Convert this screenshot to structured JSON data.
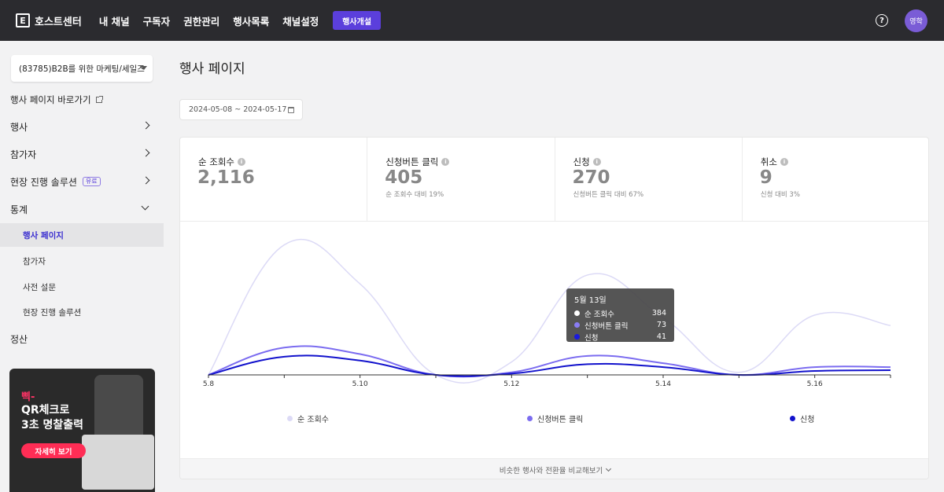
{
  "header": {
    "logo_glyph": "E",
    "brand": "호스트센터",
    "nav": [
      "내 채널",
      "구독자",
      "권한관리",
      "행사목록",
      "채널설정"
    ],
    "create_button": "행사개설",
    "help_glyph": "?",
    "avatar": "영학"
  },
  "sidebar": {
    "channel": "(83785)B2B를 위한 마케팅/세일즈",
    "shortcut": "행사 페이지 바로가기",
    "menu": {
      "event": "행사",
      "participant": "참가자",
      "onsite": "현장 진행 솔루션",
      "onsite_badge": "유료",
      "stats": "통계",
      "settlement": "정산"
    },
    "stats_sub": [
      "행사 페이지",
      "참가자",
      "사전 설문",
      "현장 진행 솔루션"
    ],
    "banner": {
      "tag": "삑-",
      "title_line1": "QR체크로",
      "title_line2": "3초 명찰출력",
      "button": "자세히 보기"
    }
  },
  "main": {
    "title": "행사 페이지",
    "date_range": "2024-05-08 ~ 2024-05-17",
    "stats": [
      {
        "label": "순 조회수",
        "value": "2,116",
        "sub": ""
      },
      {
        "label": "신청버튼 클릭",
        "value": "405",
        "sub": "순 조회수 대비 19%"
      },
      {
        "label": "신청",
        "value": "270",
        "sub": "신청버튼 클릭 대비 67%"
      },
      {
        "label": "취소",
        "value": "9",
        "sub": "신청 대비 3%"
      }
    ],
    "compare": "비슷한 행사와 전환율 비교해보기"
  },
  "chart_data": {
    "type": "line",
    "x": [
      "5.8",
      "5.9",
      "5.10",
      "5.11",
      "5.12",
      "5.13",
      "5.14",
      "5.15",
      "5.16",
      "5.17"
    ],
    "tick_labels": [
      "5.8",
      "5.10",
      "5.12",
      "5.14",
      "5.16"
    ],
    "series": [
      {
        "name": "순 조회수",
        "color": "#dcdaf6",
        "values": [
          0,
          500,
          350,
          0,
          50,
          384,
          220,
          10,
          230,
          190
        ]
      },
      {
        "name": "신청버튼 클릭",
        "color": "#7b6cf0",
        "values": [
          0,
          105,
          80,
          0,
          10,
          73,
          45,
          0,
          30,
          30
        ]
      },
      {
        "name": "신청",
        "color": "#1212cc",
        "values": [
          0,
          70,
          55,
          0,
          5,
          41,
          30,
          0,
          15,
          18
        ]
      }
    ],
    "ylim": [
      0,
      550
    ],
    "grid": false,
    "legend": "bottom",
    "tooltip": {
      "title": "5월 13일",
      "rows": [
        {
          "name": "순 조회수",
          "value": "384",
          "color": "#ffffff"
        },
        {
          "name": "신청버튼 클릭",
          "value": "73",
          "color": "#8a7df5"
        },
        {
          "name": "신청",
          "value": "41",
          "color": "#1a1adf"
        }
      ]
    }
  }
}
